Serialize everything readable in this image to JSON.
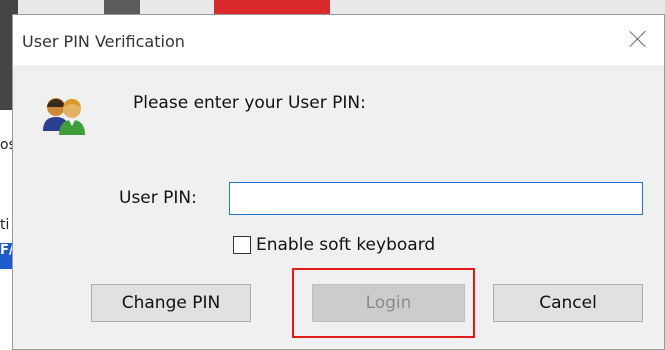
{
  "dialog": {
    "title": "User PIN Verification",
    "prompt": "Please enter your User PIN:",
    "pin_label": "User PIN:",
    "pin_value": "",
    "soft_keyboard_label": "Enable soft keyboard",
    "soft_keyboard_checked": false,
    "buttons": {
      "change_pin": "Change PIN",
      "login": "Login",
      "cancel": "Cancel"
    },
    "login_enabled": false
  },
  "background": {
    "sidebar_fragments": [
      "os",
      "ti",
      "F/"
    ]
  },
  "colors": {
    "highlight": "#e01b1b",
    "input_border": "#1c76d6",
    "disabled_text": "#8b8b8b"
  },
  "icons": {
    "users": "users-icon",
    "close": "close-icon"
  }
}
